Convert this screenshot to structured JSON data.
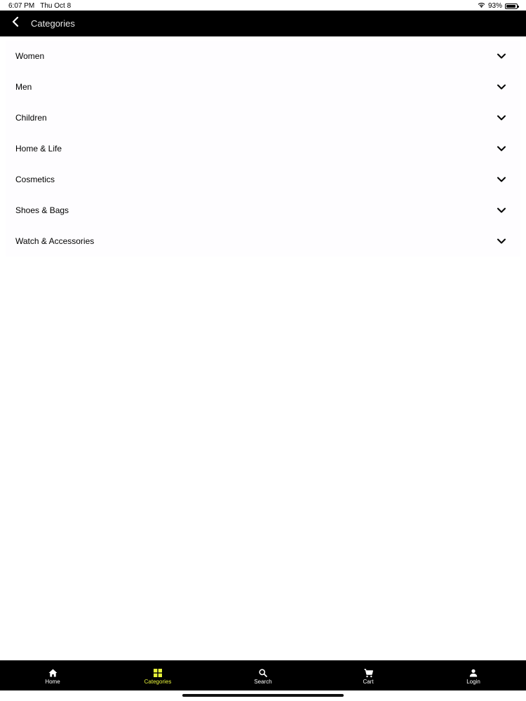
{
  "status_bar": {
    "time": "6:07 PM",
    "date": "Thu Oct 8",
    "battery": "93%"
  },
  "header": {
    "title": "Categories"
  },
  "categories": [
    {
      "label": "Women"
    },
    {
      "label": "Men"
    },
    {
      "label": "Children"
    },
    {
      "label": "Home & Life"
    },
    {
      "label": "Cosmetics"
    },
    {
      "label": "Shoes & Bags"
    },
    {
      "label": "Watch & Accessories"
    }
  ],
  "tab_bar": {
    "tabs": [
      {
        "label": "Home",
        "icon": "home-icon"
      },
      {
        "label": "Categories",
        "icon": "grid-icon",
        "active": true
      },
      {
        "label": "Search",
        "icon": "search-icon"
      },
      {
        "label": "Cart",
        "icon": "cart-icon"
      },
      {
        "label": "Login",
        "icon": "user-icon"
      }
    ]
  },
  "colors": {
    "header_bg": "#000000",
    "tab_bar_bg": "#000000",
    "active_tab": "#e6f23a",
    "list_bg": "#fefdff"
  }
}
